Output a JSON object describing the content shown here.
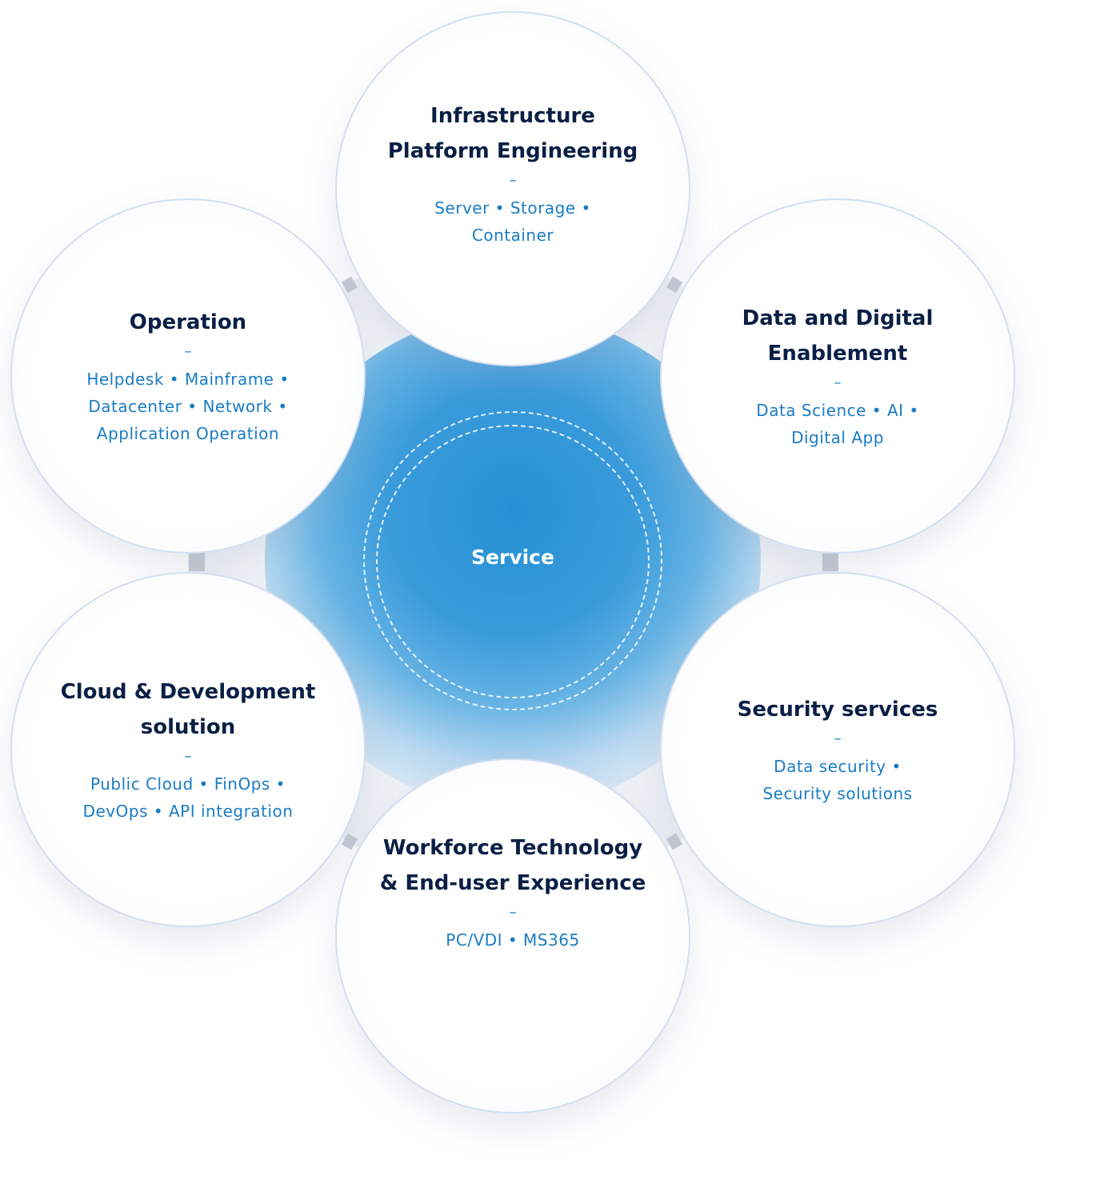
{
  "diagram": {
    "center": {
      "label": "Service",
      "color": "#2490d4"
    },
    "title_color": "#0b1f45",
    "item_color": "#1a7cc4",
    "separator": "–",
    "services": [
      {
        "id": "infrastructure",
        "title_lines": [
          "Infrastructure",
          "Platform Engineering"
        ],
        "item_lines": [
          "Server • Storage •",
          "Container"
        ]
      },
      {
        "id": "operation",
        "title_lines": [
          "Operation"
        ],
        "item_lines": [
          "Helpdesk • Mainframe •",
          "Datacenter • Network •",
          "Application Operation"
        ]
      },
      {
        "id": "data-digital",
        "title_lines": [
          "Data and Digital",
          "Enablement"
        ],
        "item_lines": [
          "Data Science • AI •",
          "Digital App"
        ]
      },
      {
        "id": "cloud-dev",
        "title_lines": [
          "Cloud & Development",
          "solution"
        ],
        "item_lines": [
          "Public Cloud • FinOps •",
          "DevOps • API integration"
        ]
      },
      {
        "id": "security",
        "title_lines": [
          "Security services"
        ],
        "item_lines": [
          "Data security •",
          "Security solutions"
        ]
      },
      {
        "id": "workforce",
        "title_lines": [
          "Workforce Technology",
          "& End-user Experience"
        ],
        "item_lines": [
          "PC/VDI • MS365"
        ]
      }
    ]
  }
}
